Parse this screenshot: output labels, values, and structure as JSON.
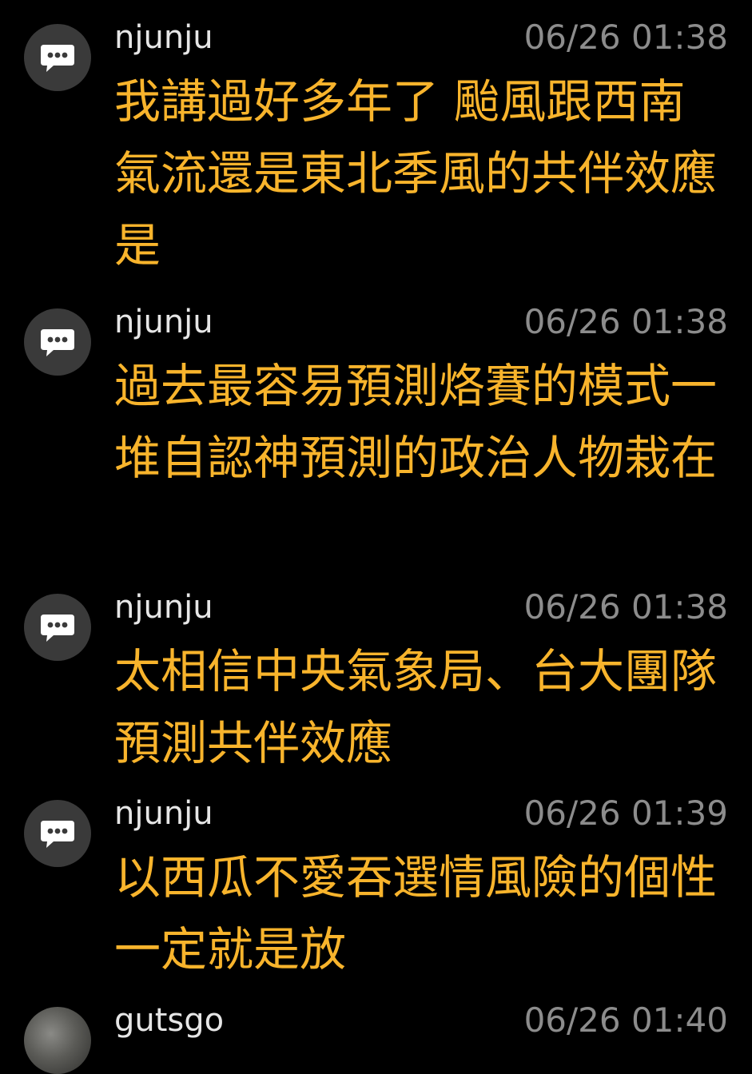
{
  "comments": [
    {
      "username": "njunju",
      "time": "06/26 01:38",
      "avatar_icon": "chat-bubble-icon",
      "text": "我講過好多年了 颱風跟西南氣流還是東北季風的共伴效應 是"
    },
    {
      "username": "njunju",
      "time": "06/26 01:38",
      "avatar_icon": "chat-bubble-icon",
      "text": "過去最容易預測烙賽的模式一堆自認神預測的政治人物栽在"
    },
    {
      "username": "njunju",
      "time": "06/26 01:38",
      "avatar_icon": "chat-bubble-icon",
      "text": "太相信中央氣象局、台大團隊預測共伴效應"
    },
    {
      "username": "njunju",
      "time": "06/26 01:39",
      "avatar_icon": "chat-bubble-icon",
      "text": "以西瓜不愛吞選情風險的個性 一定就是放"
    },
    {
      "username": "gutsgo",
      "time": "06/26 01:40",
      "avatar_icon": "user-photo-avatar",
      "text": ""
    }
  ],
  "colors": {
    "background": "#000000",
    "username": "#e6e6e6",
    "timestamp": "#8c8c8c",
    "comment_text": "#f8b42c",
    "avatar_bg": "#3a3a3a"
  }
}
